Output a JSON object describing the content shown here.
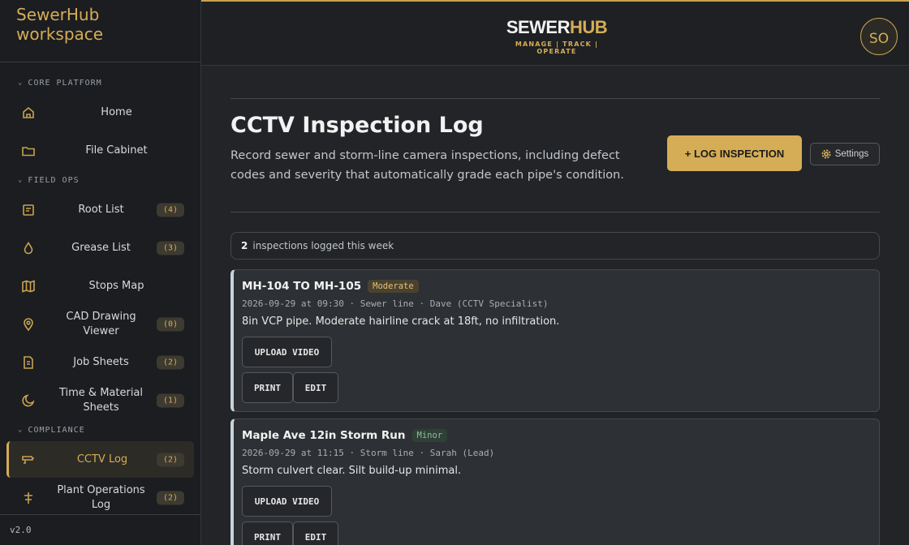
{
  "sidebar": {
    "workspace_title": "SewerHub workspace",
    "sections": [
      {
        "label": "CORE PLATFORM"
      },
      {
        "label": "FIELD OPS"
      },
      {
        "label": "COMPLIANCE"
      }
    ],
    "items": [
      {
        "label": "Home",
        "icon": "home-icon"
      },
      {
        "label": "File Cabinet",
        "icon": "folder-icon"
      },
      {
        "label": "Root List",
        "badge": "(4)",
        "icon": "list-icon"
      },
      {
        "label": "Grease List",
        "badge": "(3)",
        "icon": "droplet-icon"
      },
      {
        "label": "Stops Map",
        "icon": "map-icon"
      },
      {
        "label": "CAD Drawing Viewer",
        "badge": "(0)",
        "icon": "map-pin-icon"
      },
      {
        "label": "Job Sheets",
        "badge": "(2)",
        "icon": "document-icon"
      },
      {
        "label": "Time & Material Sheets",
        "badge": "(1)",
        "icon": "clock-icon"
      },
      {
        "label": "CCTV Log",
        "badge": "(2)",
        "icon": "cctv-camera-icon"
      },
      {
        "label": "Plant Operations Log",
        "badge": "(2)",
        "icon": "plant-icon"
      }
    ],
    "version": "v2.0"
  },
  "header": {
    "logo_sewer": "SEWER",
    "logo_hub": "HUB",
    "tagline": "MANAGE | TRACK | OPERATE",
    "avatar_initials": "SO"
  },
  "main": {
    "title": "CCTV Inspection Log",
    "description": "Record sewer and storm-line camera inspections, including defect codes and severity that automatically grade each pipe's condition.",
    "log_button": "+ LOG INSPECTION",
    "settings_button": "Settings",
    "count": "2",
    "count_label": "inspections logged this week",
    "inspections": [
      {
        "title": "MH-104 TO MH-105",
        "severity": "Moderate",
        "meta": "2026-09-29 at 09:30 · Sewer line · Dave (CCTV Specialist)",
        "description": "8in VCP pipe. Moderate hairline crack at 18ft, no infiltration.",
        "upload_label": "UPLOAD VIDEO",
        "print_label": "PRINT",
        "edit_label": "EDIT"
      },
      {
        "title": "Maple Ave 12in Storm Run",
        "severity": "Minor",
        "meta": "2026-09-29 at 11:15 · Storm line · Sarah (Lead)",
        "description": "Storm culvert clear. Silt build-up minimal.",
        "upload_label": "UPLOAD VIDEO",
        "print_label": "PRINT",
        "edit_label": "EDIT"
      }
    ]
  }
}
